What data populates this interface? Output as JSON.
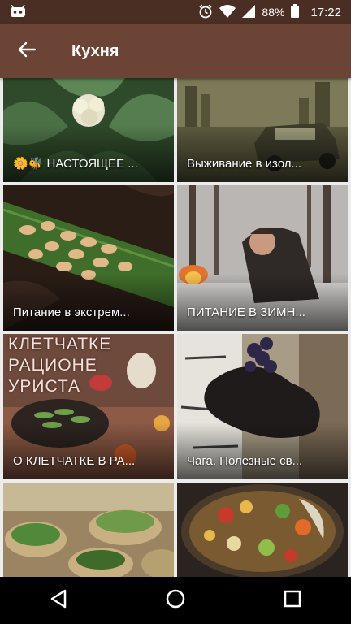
{
  "status_bar": {
    "battery": "88%",
    "time": "17:22",
    "icons": [
      "android-debug-icon",
      "alarm-icon",
      "wifi-icon",
      "signal-icon",
      "battery-icon"
    ]
  },
  "app_bar": {
    "title": "Кухня",
    "back_icon": "arrow-left-icon"
  },
  "tiles": [
    {
      "caption": "🌼🐝 НАСТОЯЩЕЕ ...",
      "image": "cauliflower-on-leaves"
    },
    {
      "caption": "Выживание в изол...",
      "image": "jeep-in-ruined-city"
    },
    {
      "caption": "Питание в экстрем...",
      "image": "larvae-on-leaf"
    },
    {
      "caption": "ПИТАНИЕ В ЗИМН...",
      "image": "man-in-winter-forest"
    },
    {
      "caption": "О КЛЕТЧАТКЕ В РА...",
      "image": "vegetables-and-greens",
      "overlay_text": [
        "КЛЕТЧАТКЕ",
        "РАЦИОНЕ",
        "УРИСТА"
      ]
    },
    {
      "caption": "Чага. Полезные св...",
      "image": "chaga-on-birch"
    },
    {
      "caption": "",
      "image": "herbs-in-bowls"
    },
    {
      "caption": "",
      "image": "soup-with-vegetables"
    }
  ],
  "nav_bar": {
    "back": "triangle-back-icon",
    "home": "circle-home-icon",
    "recents": "square-recents-icon"
  },
  "colors": {
    "status_bar": "#4a2e24",
    "app_bar": "#6b4435",
    "grid_background": "#ececec"
  }
}
